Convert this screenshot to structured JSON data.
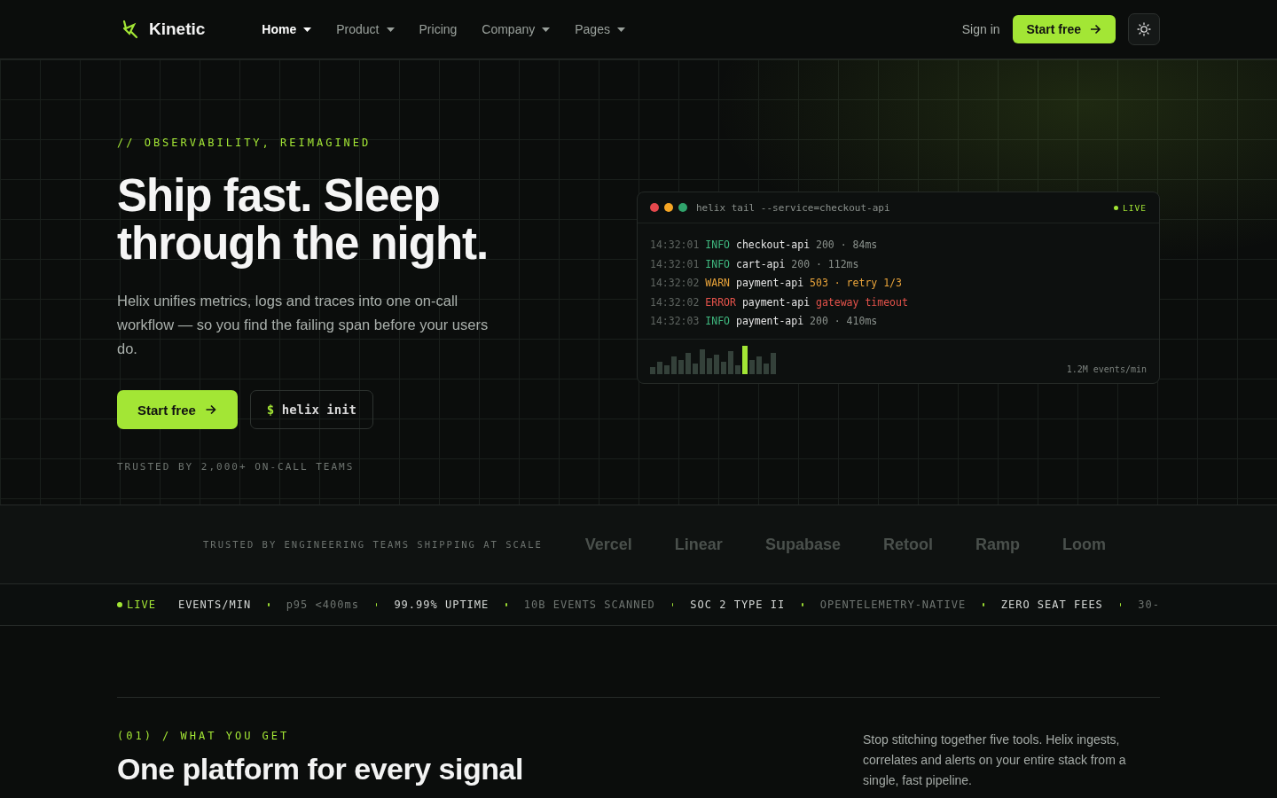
{
  "brand": {
    "name": "Kinetic"
  },
  "nav": [
    {
      "label": "Home",
      "has_menu": true,
      "selected": true
    },
    {
      "label": "Product",
      "has_menu": true,
      "selected": false
    },
    {
      "label": "Pricing",
      "has_menu": false,
      "selected": false
    },
    {
      "label": "Company",
      "has_menu": true,
      "selected": false
    },
    {
      "label": "Pages",
      "has_menu": true,
      "selected": false
    }
  ],
  "header_actions": {
    "sign_in": "Sign in",
    "cta": "Start free"
  },
  "hero": {
    "eyebrow": "// OBSERVABILITY, REIMAGINED",
    "title_lines": [
      "Ship fast. Sleep",
      "through the night."
    ],
    "lead": "Helix unifies metrics, logs and traces into one on-call workflow — so you find the failing span before your users do.",
    "primary": "Start free",
    "command_prompt": "$",
    "command": "helix init",
    "trust": "TRUSTED BY 2,000+ ON-CALL TEAMS"
  },
  "terminal": {
    "command": "helix tail --service=checkout-api",
    "status": "LIVE",
    "lines": [
      {
        "time": "14:32:01",
        "level": "INFO",
        "kind": "info",
        "service": "checkout-api",
        "detail": "200 · 84ms"
      },
      {
        "time": "14:32:01",
        "level": "INFO",
        "kind": "info",
        "service": "cart-api",
        "detail": "200 · 112ms"
      },
      {
        "time": "14:32:02",
        "level": "WARN",
        "kind": "warn",
        "service": "payment-api",
        "detail": "503 · retry 1/3"
      },
      {
        "time": "14:32:02",
        "level": "ERROR",
        "kind": "error",
        "service": "payment-api",
        "detail": "gateway timeout"
      },
      {
        "time": "14:32:03",
        "level": "INFO",
        "kind": "info",
        "service": "payment-api",
        "detail": "200 · 410ms"
      }
    ],
    "rate": "1.2M events/min"
  },
  "logos": {
    "label": "TRUSTED BY ENGINEERING TEAMS SHIPPING AT SCALE",
    "names": [
      "Vercel",
      "Linear",
      "Supabase",
      "Retool",
      "Ramp",
      "Loom"
    ]
  },
  "ticker": {
    "status": "LIVE",
    "items": [
      {
        "text": "EVENTS/MIN",
        "emphasis": true
      },
      {
        "text": "p95 <400ms",
        "emphasis": false
      },
      {
        "text": "99.99% UPTIME",
        "emphasis": true
      },
      {
        "text": "10B EVENTS SCANNED",
        "emphasis": false
      },
      {
        "text": "SOC 2 TYPE II",
        "emphasis": true
      },
      {
        "text": "OPENTELEMETRY-NATIVE",
        "emphasis": false
      },
      {
        "text": "ZERO SEAT FEES",
        "emphasis": true
      },
      {
        "text": "30-",
        "emphasis": false
      }
    ]
  },
  "features": {
    "eyebrow": "(01) / WHAT YOU GET",
    "title": "One platform for every signal",
    "lead": "Stop stitching together five tools. Helix ingests, correlates and alerts on your entire stack from a single, fast pipeline."
  }
}
